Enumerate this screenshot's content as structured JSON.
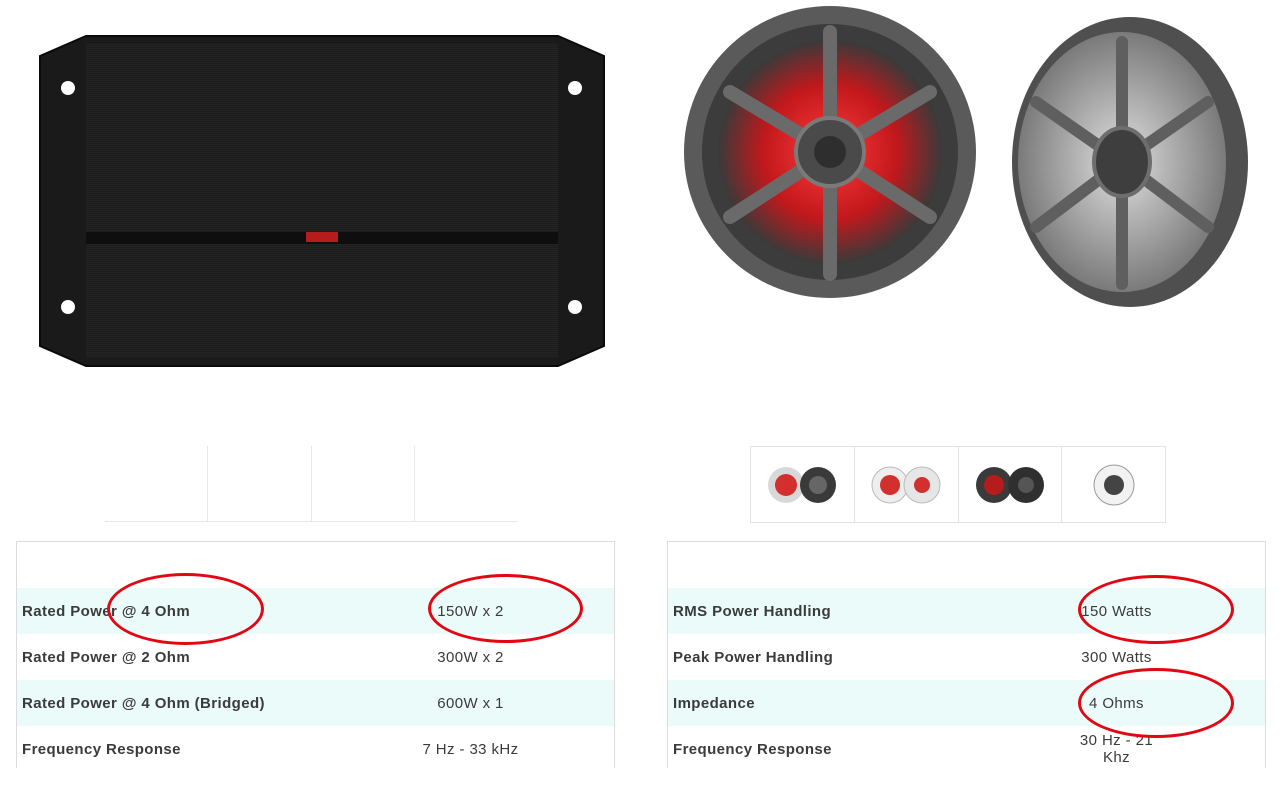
{
  "amplifier": {
    "image_label": "amplifier-product-image"
  },
  "speakers": {
    "image_label": "marine-speakers-product-image"
  },
  "thumbnails": [
    {
      "name": "thumb-charcoal-red",
      "accent": "#d32f2f"
    },
    {
      "name": "thumb-white-red",
      "accent": "#d32f2f"
    },
    {
      "name": "thumb-charcoal-dark",
      "accent": "#b71c1c"
    },
    {
      "name": "thumb-white-single",
      "accent": "#bdbdbd"
    }
  ],
  "amp_specs": [
    {
      "label": "Rated Power @ 4 Ohm",
      "value": "150W x 2"
    },
    {
      "label": "Rated Power @ 2 Ohm",
      "value": "300W x 2"
    },
    {
      "label": "Rated Power @ 4 Ohm (Bridged)",
      "value": "600W x 1"
    },
    {
      "label": "Frequency Response",
      "value": "7 Hz - 33 kHz"
    }
  ],
  "speaker_specs": [
    {
      "label": "RMS Power Handling",
      "value": "150 Watts"
    },
    {
      "label": "Peak Power Handling",
      "value": "300 Watts"
    },
    {
      "label": "Impedance",
      "value": "4 Ohms"
    },
    {
      "label": "Frequency Response",
      "value": "30 Hz - 21 Khz"
    }
  ],
  "colors": {
    "row_highlight": "#ebfbfa",
    "annotation": "#e30613",
    "text": "#3b3b3b"
  }
}
